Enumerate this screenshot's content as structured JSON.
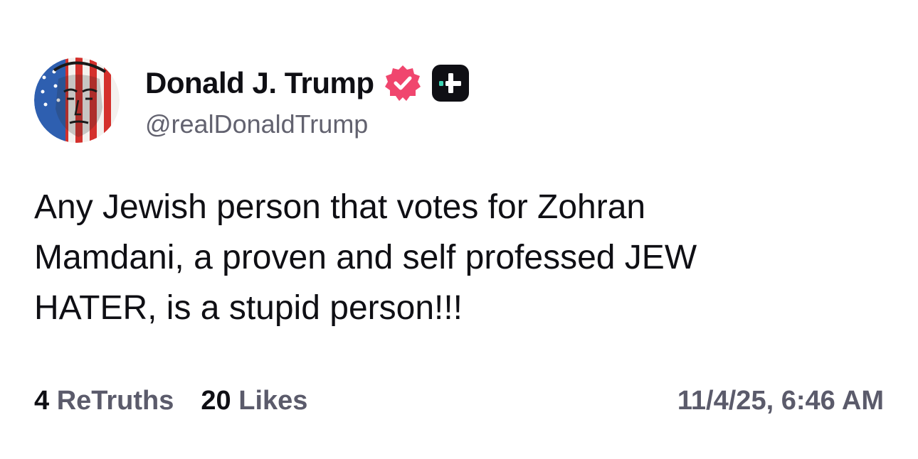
{
  "post": {
    "author": {
      "display_name": "Donald J. Trump",
      "handle": "@realDonaldTrump",
      "avatar_icon": "profile-avatar",
      "verified_icon": "verified-badge-icon",
      "plus_icon": "plus-badge-icon"
    },
    "text": "Any Jewish person that votes for Zohran\nMamdani, a proven and self professed JEW\nHATER, is a stupid person!!!",
    "stats": {
      "retruths_count": "4",
      "retruths_label": "ReTruths",
      "likes_count": "20",
      "likes_label": "Likes"
    },
    "timestamp": "11/4/25, 6:46 AM"
  },
  "colors": {
    "text_primary": "#0f0f14",
    "text_secondary": "#5b5b6b",
    "verified_pink": "#f0466e",
    "plus_teal": "#3ed6b5"
  }
}
